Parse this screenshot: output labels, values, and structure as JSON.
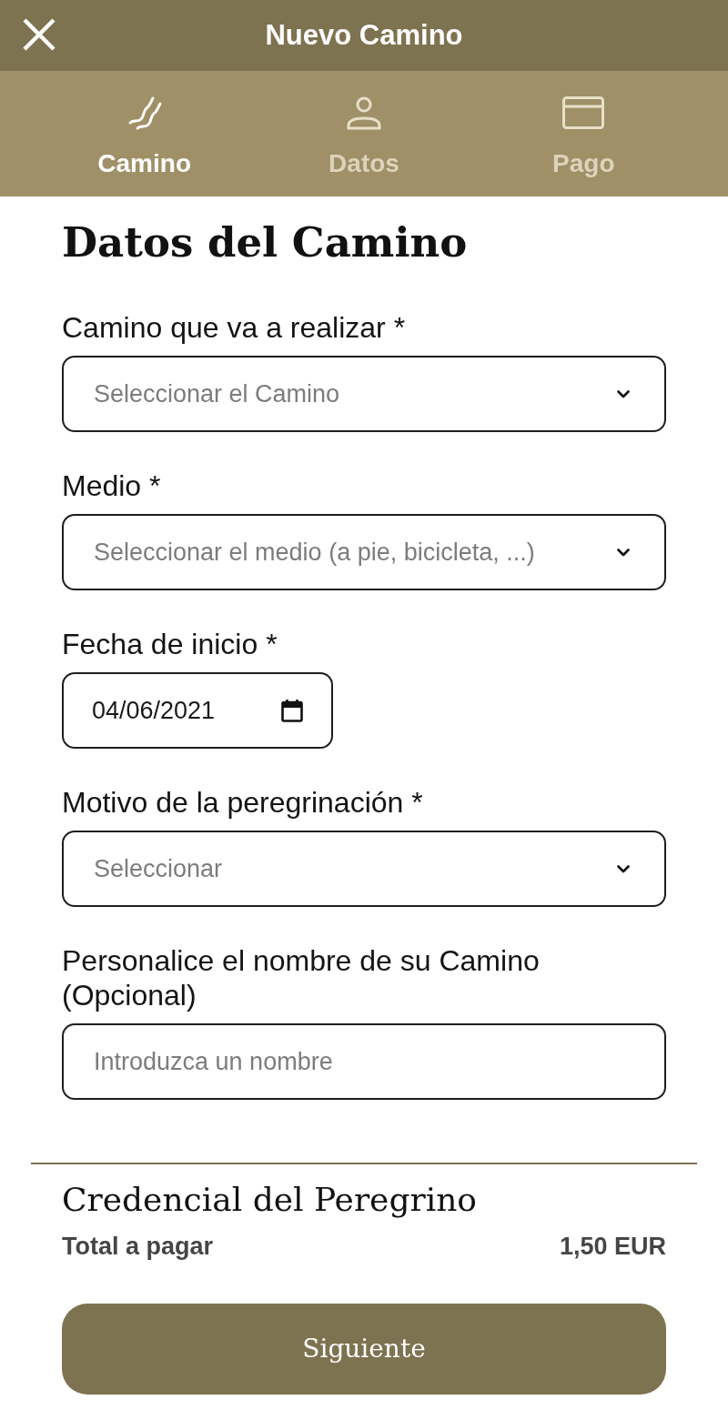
{
  "header": {
    "title": "Nuevo Camino"
  },
  "steps": [
    {
      "label": "Camino",
      "selected": true,
      "kind": "route"
    },
    {
      "label": "Datos",
      "selected": false,
      "kind": "person"
    },
    {
      "label": "Pago",
      "selected": false,
      "kind": "card"
    }
  ],
  "section_title": "Datos del Camino",
  "fields": [
    {
      "kind": "select",
      "label": "Camino que va a realizar *",
      "placeholder": "Seleccionar el Camino"
    },
    {
      "kind": "select",
      "label": "Medio *",
      "placeholder": "Seleccionar el medio (a pie, bicicleta, ...)"
    },
    {
      "kind": "date",
      "label": "Fecha de inicio *",
      "value": "04/06/2021"
    },
    {
      "kind": "select",
      "label": "Motivo de la peregrinación *",
      "placeholder": "Seleccionar"
    },
    {
      "kind": "text",
      "label": "Personalice el nombre de su Camino (Opcional)",
      "placeholder": "Introduzca un nombre"
    }
  ],
  "summary": {
    "title": "Credencial del Peregrino",
    "total_label": "Total a pagar",
    "total_value": "1,50 EUR"
  },
  "next_button": "Siguiente"
}
